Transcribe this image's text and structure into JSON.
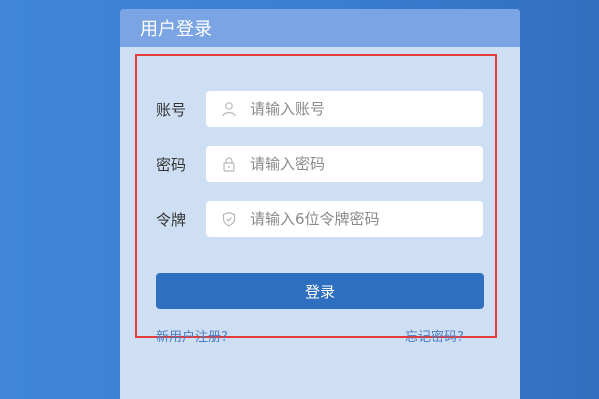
{
  "panel": {
    "title": "用户登录"
  },
  "form": {
    "account": {
      "label": "账号",
      "placeholder": "请输入账号",
      "icon": "user-icon"
    },
    "password": {
      "label": "密码",
      "placeholder": "请输入密码",
      "icon": "lock-icon"
    },
    "token": {
      "label": "令牌",
      "placeholder": "请输入6位令牌密码",
      "icon": "shield-icon"
    },
    "submit_label": "登录"
  },
  "links": {
    "register": "新用户注册?",
    "forgot_password": "忘记密码?"
  },
  "colors": {
    "header": "#7aa4e3",
    "panel": "#cfdff3",
    "button": "#2f6fbf",
    "highlight": "#e23b3b",
    "link": "#4a7ec3"
  }
}
